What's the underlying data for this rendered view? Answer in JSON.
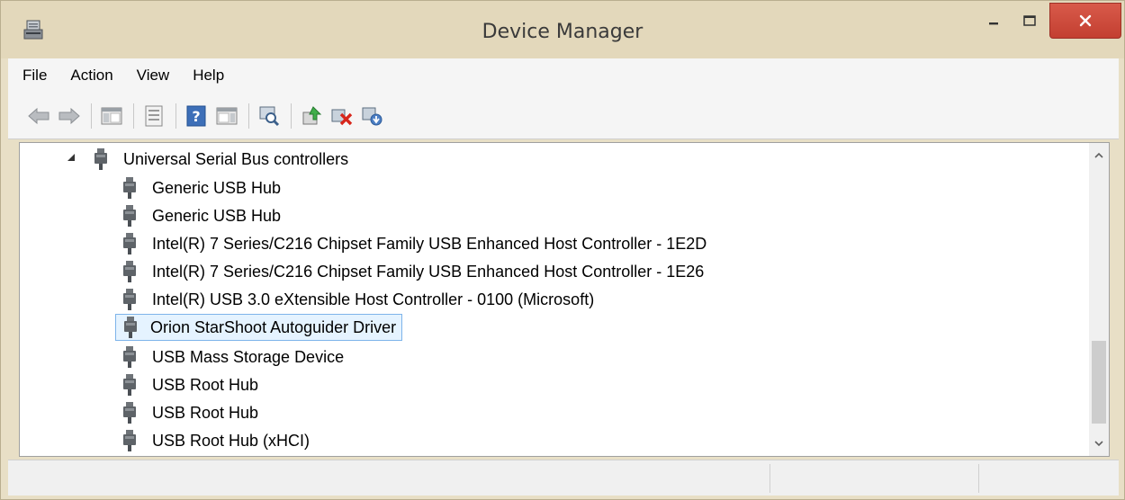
{
  "window": {
    "title": "Device Manager"
  },
  "menu": [
    "File",
    "Action",
    "View",
    "Help"
  ],
  "toolbar": {
    "buttons": [
      "back-icon",
      "forward-icon",
      "show-hide-console-tree-icon",
      "properties-icon",
      "help-icon",
      "action-pane-icon",
      "scan-hardware-icon",
      "update-driver-icon",
      "uninstall-device-icon",
      "enable-device-icon"
    ]
  },
  "tree": {
    "category": "Universal Serial Bus controllers",
    "devices": [
      "Generic USB Hub",
      "Generic USB Hub",
      "Intel(R) 7 Series/C216 Chipset Family USB Enhanced Host Controller - 1E2D",
      "Intel(R) 7 Series/C216 Chipset Family USB Enhanced Host Controller - 1E26",
      "Intel(R) USB 3.0 eXtensible Host Controller - 0100 (Microsoft)",
      "Orion StarShoot Autoguider Driver",
      "USB Mass Storage Device",
      "USB Root Hub",
      "USB Root Hub",
      "USB Root Hub (xHCI)"
    ],
    "selected": "Orion StarShoot Autoguider Driver"
  },
  "colors": {
    "selection_border": "#7eb4ea",
    "selection_bg": "#e5f3ff",
    "close_button": "#c9453a"
  }
}
